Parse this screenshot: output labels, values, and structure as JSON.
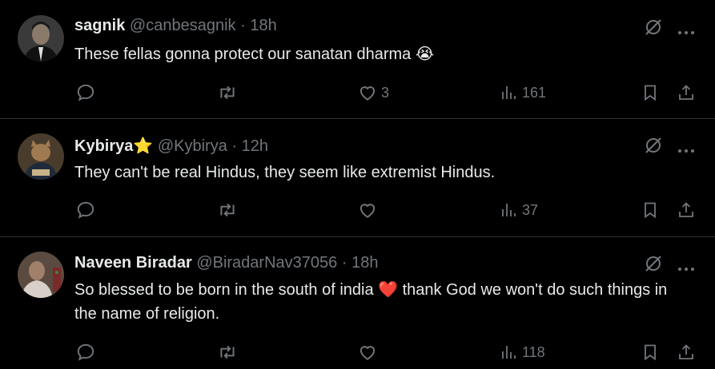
{
  "replies": [
    {
      "name": "sagnik",
      "handle": "@canbesagnik",
      "time": "18h",
      "text": "These fellas gonna protect our sanatan dharma",
      "emoji": "😭",
      "likes": "3",
      "views": "161"
    },
    {
      "name": "Kybirya",
      "name_badge": "⭐",
      "handle": "@Kybirya",
      "time": "12h",
      "text": "They can't be real Hindus, they seem like extremist Hindus.",
      "likes": "",
      "views": "37"
    },
    {
      "name": "Naveen Biradar",
      "handle": "@BiradarNav37056",
      "time": "18h",
      "text_part1": "So blessed to be born in the south of india",
      "emoji": "❤️",
      "text_part2": "thank God we won't do such things in the name of religion.",
      "likes": "",
      "views": "118"
    }
  ],
  "separator": "·",
  "colors": {
    "background": "#000000",
    "text": "#e7e9ea",
    "muted": "#71767b",
    "divider": "#2f3336"
  },
  "icons": [
    "reply-icon",
    "retweet-icon",
    "like-icon",
    "views-icon",
    "bookmark-icon",
    "share-icon",
    "grok-icon",
    "more-icon"
  ]
}
